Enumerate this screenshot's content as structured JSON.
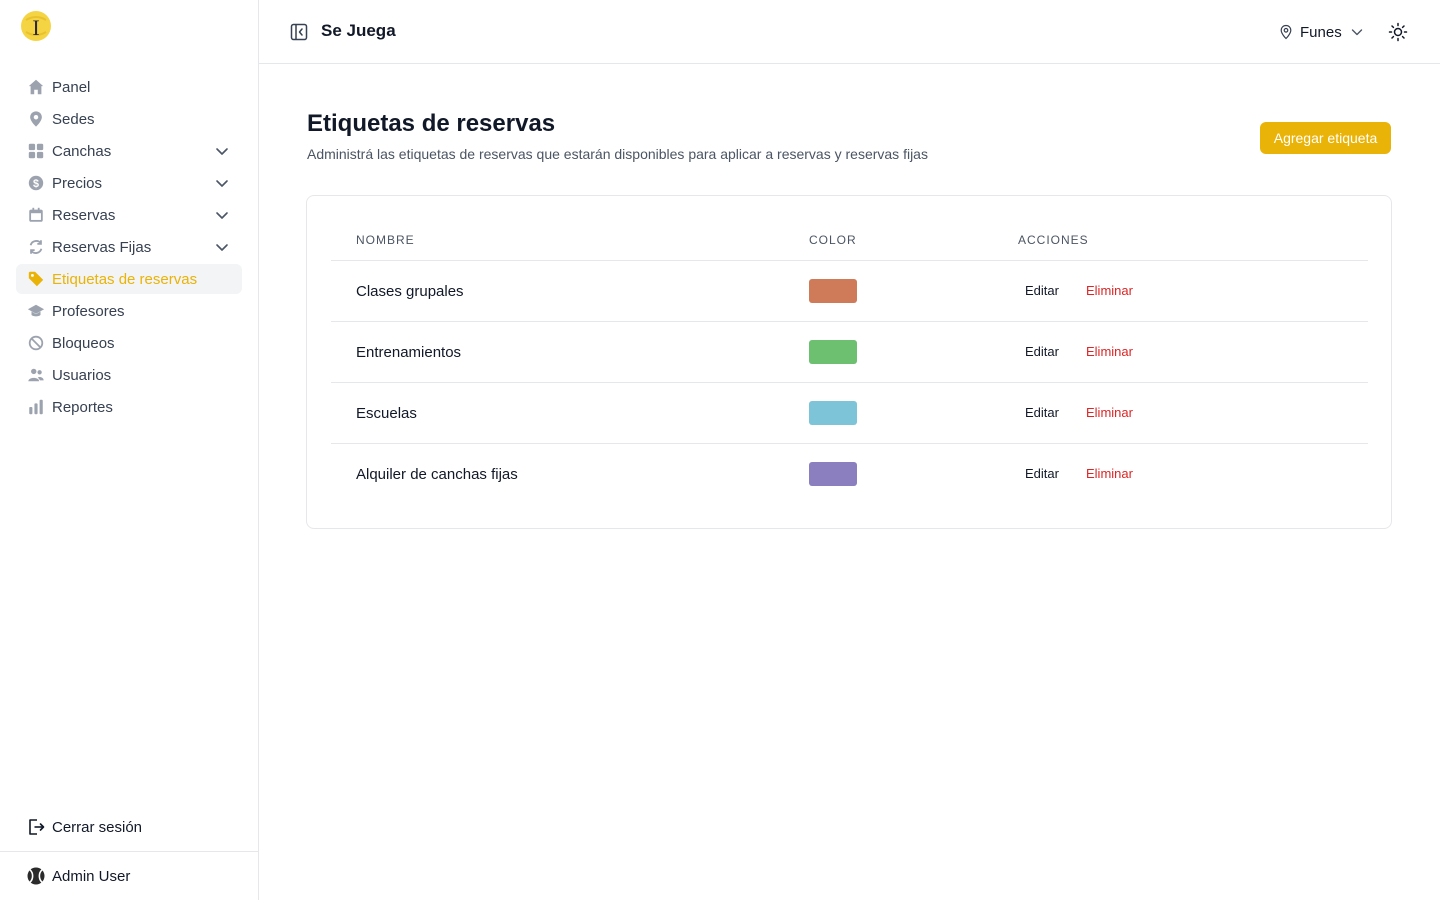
{
  "app": {
    "title": "Se Juega"
  },
  "sidebar": {
    "items": [
      {
        "label": "Panel",
        "icon": "home-icon",
        "expandable": false,
        "active": false
      },
      {
        "label": "Sedes",
        "icon": "map-pin-icon",
        "expandable": false,
        "active": false
      },
      {
        "label": "Canchas",
        "icon": "grid-icon",
        "expandable": true,
        "active": false
      },
      {
        "label": "Precios",
        "icon": "dollar-icon",
        "expandable": true,
        "active": false
      },
      {
        "label": "Reservas",
        "icon": "calendar-icon",
        "expandable": true,
        "active": false
      },
      {
        "label": "Reservas Fijas",
        "icon": "refresh-icon",
        "expandable": true,
        "active": false
      },
      {
        "label": "Etiquetas de reservas",
        "icon": "tag-icon",
        "expandable": false,
        "active": true
      },
      {
        "label": "Profesores",
        "icon": "academic-cap-icon",
        "expandable": false,
        "active": false
      },
      {
        "label": "Bloqueos",
        "icon": "ban-icon",
        "expandable": false,
        "active": false
      },
      {
        "label": "Usuarios",
        "icon": "users-icon",
        "expandable": false,
        "active": false
      },
      {
        "label": "Reportes",
        "icon": "bar-chart-icon",
        "expandable": false,
        "active": false
      }
    ],
    "logout_label": "Cerrar sesión",
    "user_name": "Admin User"
  },
  "header": {
    "location": "Funes"
  },
  "main": {
    "title": "Etiquetas de reservas",
    "subtitle": "Administrá las etiquetas de reservas que estarán disponibles para aplicar a reservas y reservas fijas",
    "add_button": "Agregar etiqueta",
    "table": {
      "columns": [
        "NOMBRE",
        "COLOR",
        "ACCIONES"
      ],
      "rows": [
        {
          "name": "Clases grupales",
          "color": "#cf7b59",
          "edit": "Editar",
          "delete": "Eliminar"
        },
        {
          "name": "Entrenamientos",
          "color": "#6cc070",
          "edit": "Editar",
          "delete": "Eliminar"
        },
        {
          "name": "Escuelas",
          "color": "#7ec4d8",
          "edit": "Editar",
          "delete": "Eliminar"
        },
        {
          "name": "Alquiler de canchas fijas",
          "color": "#8b7fbf",
          "edit": "Editar",
          "delete": "Eliminar"
        }
      ]
    }
  },
  "colors": {
    "accent": "#eab308",
    "danger": "#dc2626",
    "border": "#e5e7eb"
  }
}
